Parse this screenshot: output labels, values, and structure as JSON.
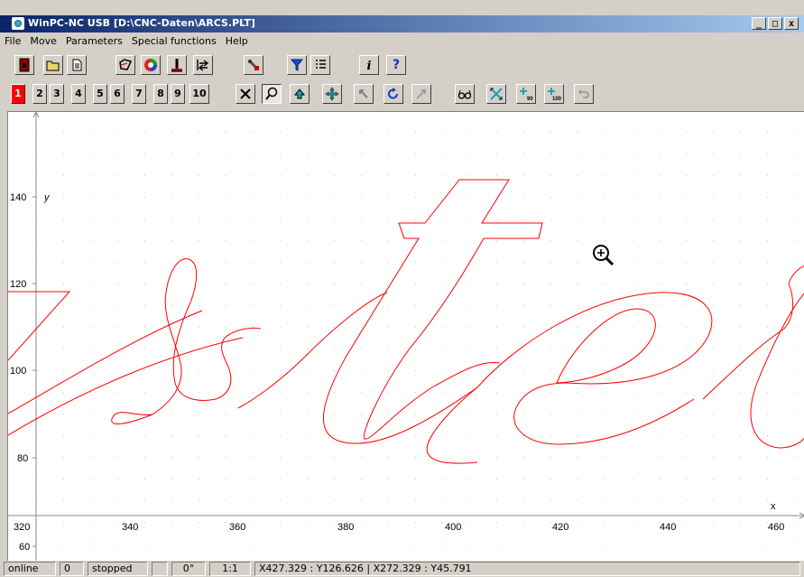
{
  "window": {
    "title": "WinPC-NC USB [D:\\CNC-Daten\\ARCS.PLT]",
    "buttons": [
      "_",
      "□",
      "x"
    ]
  },
  "menu": [
    "File",
    "Move",
    "Parameters",
    "Special functions",
    "Help"
  ],
  "toolbar": {
    "main_icons": [
      "exit-door-icon",
      "open-folder-icon",
      "document-icon",
      "polygon-icon",
      "color-wheel-icon",
      "reference-icon",
      "move-home-icon",
      "tool-icon",
      "filter-icon",
      "list-icon",
      "info-icon",
      "help-icon"
    ],
    "help_label": "?",
    "layer_buttons": [
      "1",
      "2",
      "3",
      "4",
      "5",
      "6",
      "7",
      "8",
      "9",
      "10"
    ],
    "active_layer": "1",
    "view_icons": [
      "close-view-icon",
      "zoom-icon",
      "pan-up-icon",
      "pan-move-icon",
      "arrow-icon",
      "rotate-icon",
      "transform-icon",
      "glasses-icon",
      "fit-icon",
      "rotate-90-icon",
      "scale-100-icon",
      "undo-icon"
    ]
  },
  "canvas": {
    "x_axis_label": "x",
    "y_axis_label": "y",
    "x_ticks": [
      "320",
      "340",
      "360",
      "380",
      "400",
      "420",
      "440",
      "460"
    ],
    "y_ticks": [
      "140",
      "120",
      "100",
      "80",
      "60"
    ],
    "line_color": "#ff0000",
    "cursor": "zoom-in-magnifier"
  },
  "status": {
    "connection": "online",
    "count": "0",
    "state": "stopped",
    "empty1": "",
    "angle": "0°",
    "scale": "1:1",
    "coordinates": "X427.329 : Y126.626  |  X272.329 : Y45.791"
  },
  "colors": {
    "accent_red": "#ff0000",
    "title_blue": "#0a246a",
    "face": "#d4d0c8"
  }
}
